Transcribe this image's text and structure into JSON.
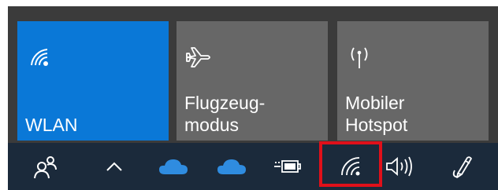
{
  "quick_actions": {
    "tiles": [
      {
        "label": "WLAN",
        "icon": "wifi-icon",
        "active": true
      },
      {
        "label": "Flugzeug-\nmodus",
        "icon": "airplane-icon",
        "active": false
      },
      {
        "label": "Mobiler\nHotspot",
        "icon": "mobile-hotspot-icon",
        "active": false
      }
    ]
  },
  "taskbar": {
    "icons": [
      "people-icon",
      "chevron-up-icon",
      "onedrive-cloud-icon",
      "onedrive-cloud-icon",
      "battery-charging-icon",
      "wifi-icon",
      "volume-icon",
      "pen-icon"
    ],
    "highlighted": "wifi-icon"
  },
  "colors": {
    "active_tile": "#0a78d7",
    "inactive_tile": "#676767",
    "taskbar": "#1b2a3b",
    "highlight": "#e0101a",
    "cloud": "#2f8ce0"
  }
}
